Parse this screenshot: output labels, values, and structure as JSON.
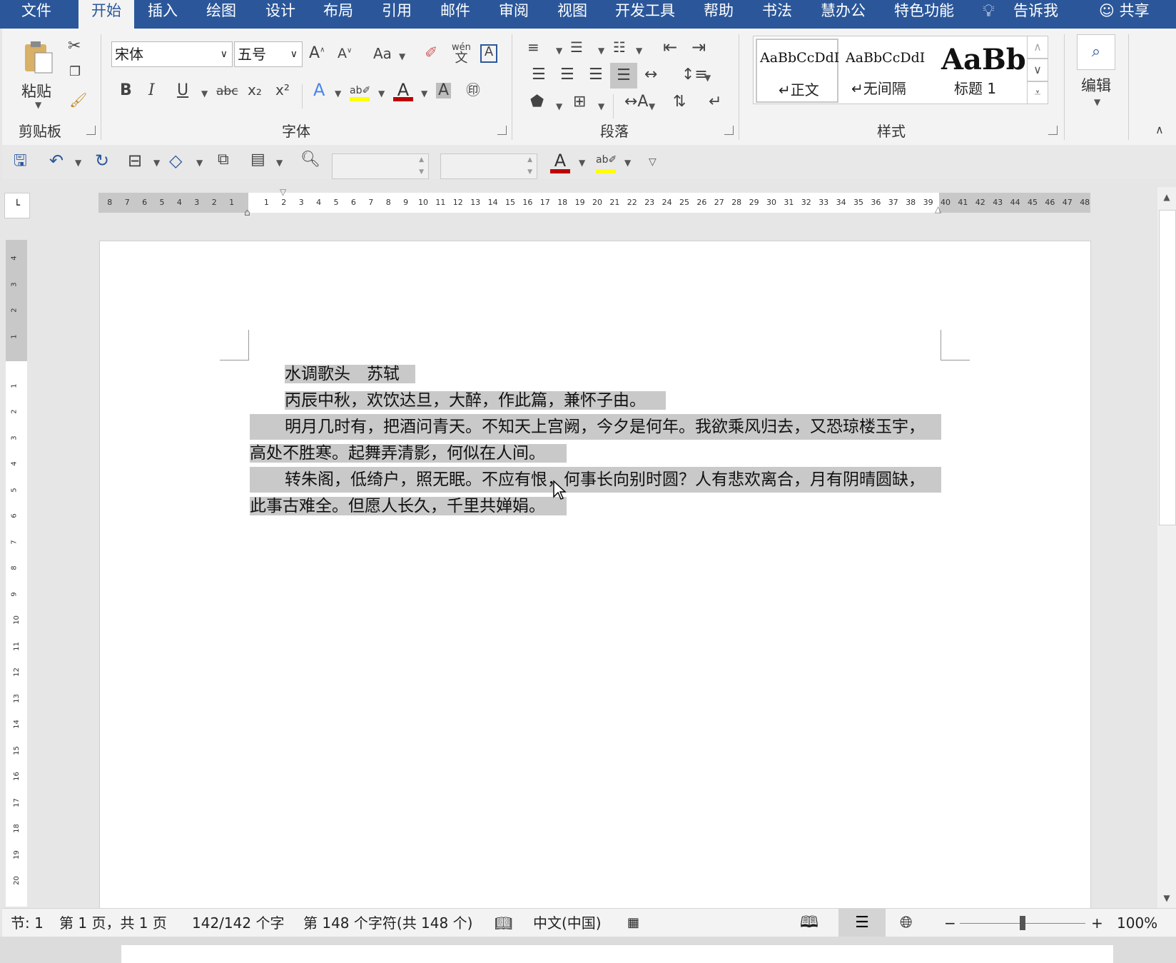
{
  "menu": {
    "tabs": [
      "文件",
      "开始",
      "插入",
      "绘图",
      "设计",
      "布局",
      "引用",
      "邮件",
      "审阅",
      "视图",
      "开发工具",
      "帮助",
      "书法",
      "慧办公",
      "特色功能"
    ],
    "active_tab": "开始",
    "tell_me": "告诉我",
    "share": "共享"
  },
  "ribbon": {
    "clipboard": {
      "paste_label": "粘贴",
      "group_label": "剪贴板"
    },
    "font": {
      "font_name": "宋体",
      "font_size": "五号",
      "change_case": "Aa",
      "group_label": "字体",
      "bold": "B",
      "italic": "I",
      "underline": "U",
      "strike": "abc",
      "subscript": "x₂",
      "superscript": "x²",
      "phonetic_top": "wén",
      "phonetic_bottom": "文"
    },
    "paragraph": {
      "group_label": "段落"
    },
    "styles": {
      "group_label": "样式",
      "items": [
        {
          "preview": "AaBbCcDdI",
          "label": "正文"
        },
        {
          "preview": "AaBbCcDdI",
          "label": "无间隔"
        },
        {
          "preview": "AaBb",
          "label": "标题 1"
        }
      ]
    },
    "editing": {
      "label": "编辑"
    }
  },
  "hruler": {
    "left_numbers": [
      "8",
      "7",
      "6",
      "5",
      "4",
      "3",
      "2",
      "1"
    ],
    "right_numbers": [
      "1",
      "2",
      "3",
      "4",
      "5",
      "6",
      "7",
      "8",
      "9",
      "10",
      "11",
      "12",
      "13",
      "14",
      "15",
      "16",
      "17",
      "18",
      "19",
      "20",
      "21",
      "22",
      "23",
      "24",
      "25",
      "26",
      "27",
      "28",
      "29",
      "30",
      "31",
      "32",
      "33",
      "34",
      "35",
      "36",
      "37",
      "38",
      "39",
      "40",
      "41",
      "42",
      "43",
      "44",
      "45",
      "46",
      "47",
      "48"
    ]
  },
  "vruler": {
    "top_numbers": [
      "4",
      "3",
      "2",
      "1"
    ],
    "numbers": [
      "1",
      "2",
      "3",
      "4",
      "5",
      "6",
      "7",
      "8",
      "9",
      "10",
      "11",
      "12",
      "13",
      "14",
      "15",
      "16",
      "17",
      "18",
      "19",
      "20"
    ]
  },
  "document": {
    "lines": [
      "水调歌头　苏轼",
      "丙辰中秋，欢饮达旦，大醉，作此篇，兼怀子由。",
      "明月几时有，把酒问青天。不知天上宫阙，今夕是何年。我欲乘风归去，又恐琼楼玉宇，",
      "高处不胜寒。起舞弄清影，何似在人间。",
      "转朱阁，低绮户，照无眠。不应有恨，何事长向别时圆？人有悲欢离合，月有阴晴圆缺，",
      "此事古难全。但愿人长久，千里共婵娟。"
    ]
  },
  "status": {
    "section": "节: 1",
    "page": "第 1 页，共 1 页",
    "words": "142/142 个字",
    "chars": "第 148 个字符(共 148 个)",
    "language": "中文(中国)",
    "zoom": "100%",
    "zoom_minus": "−",
    "zoom_plus": "+",
    "zoom_level": 0.5
  },
  "colors": {
    "accent": "#2b579a",
    "font_color": "#c00000",
    "highlight": "#ffff00",
    "selection": "#c9c9c9"
  }
}
